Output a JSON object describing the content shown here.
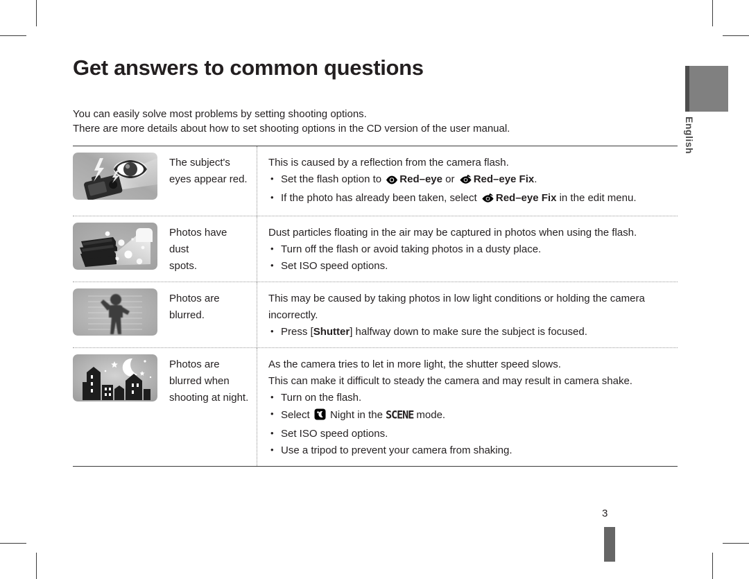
{
  "page": {
    "title": "Get answers to common questions",
    "intro_lines": [
      "You can easily solve most problems by setting shooting options.",
      "There are more details about how to set shooting options in the CD version of the user manual."
    ],
    "page_number": "3",
    "language_tab": "English"
  },
  "table": {
    "rows": [
      {
        "icon_name": "red-eye-camera-thumbnail",
        "symptom_lines": [
          "The subject's",
          "eyes appear red."
        ],
        "intro": "This is caused by a reflection from the camera flash.",
        "bullets": [
          {
            "segments": [
              {
                "text": "Set the flash option to ",
                "style": "normal"
              },
              {
                "text": "red-eye-icon",
                "style": "icon"
              },
              {
                "text": "Red–eye",
                "style": "bold"
              },
              {
                "text": " or ",
                "style": "normal"
              },
              {
                "text": "red-eye-fix-icon",
                "style": "icon"
              },
              {
                "text": "Red–eye Fix",
                "style": "bold"
              },
              {
                "text": ".",
                "style": "normal"
              }
            ]
          },
          {
            "segments": [
              {
                "text": "If the photo has already been taken, select ",
                "style": "normal"
              },
              {
                "text": "red-eye-fix-icon",
                "style": "icon"
              },
              {
                "text": "Red–eye Fix",
                "style": "bold"
              },
              {
                "text": " in the edit menu.",
                "style": "normal"
              }
            ]
          }
        ]
      },
      {
        "icon_name": "dust-books-flash-thumbnail",
        "symptom_lines": [
          "Photos have",
          "dust",
          "spots."
        ],
        "intro": "Dust particles floating in the air may be captured in photos when using the flash.",
        "bullets": [
          {
            "segments": [
              {
                "text": "Turn off the flash or avoid taking photos in a dusty place.",
                "style": "normal"
              }
            ]
          },
          {
            "segments": [
              {
                "text": "Set ISO speed options.",
                "style": "normal"
              }
            ]
          }
        ]
      },
      {
        "icon_name": "blurred-person-thumbnail",
        "symptom_lines": [
          "Photos are",
          "blurred."
        ],
        "intro": "This may be caused by taking photos in low light conditions or holding the camera incorrectly.",
        "bullets": [
          {
            "segments": [
              {
                "text": "Press [",
                "style": "normal"
              },
              {
                "text": "Shutter",
                "style": "bold"
              },
              {
                "text": "] halfway down to make sure the subject is focused.",
                "style": "normal"
              }
            ]
          }
        ]
      },
      {
        "icon_name": "night-cityscape-thumbnail",
        "symptom_lines": [
          "Photos are",
          "blurred when",
          "shooting at night."
        ],
        "intro": "As the camera tries to let in more light, the shutter speed slows.",
        "intro2": "This can make it difficult to steady the camera and may result in camera shake.",
        "bullets": [
          {
            "segments": [
              {
                "text": "Turn on the flash.",
                "style": "normal"
              }
            ]
          },
          {
            "segments": [
              {
                "text": "Select ",
                "style": "normal"
              },
              {
                "text": "night-mode-icon",
                "style": "icon"
              },
              {
                "text": " Night in the ",
                "style": "normal"
              },
              {
                "text": "SCENE",
                "style": "scene"
              },
              {
                "text": " mode.",
                "style": "normal"
              }
            ]
          },
          {
            "segments": [
              {
                "text": "Set ISO speed options.",
                "style": "normal"
              }
            ]
          },
          {
            "segments": [
              {
                "text": "Use a tripod to prevent your camera from shaking.",
                "style": "normal"
              }
            ]
          }
        ]
      }
    ]
  },
  "colors": {
    "text": "#231f20",
    "rule": "#3a3a3a",
    "tab_gray": "#808080",
    "tab_edge": "#4d4d4d",
    "footer_bar": "#666666"
  }
}
